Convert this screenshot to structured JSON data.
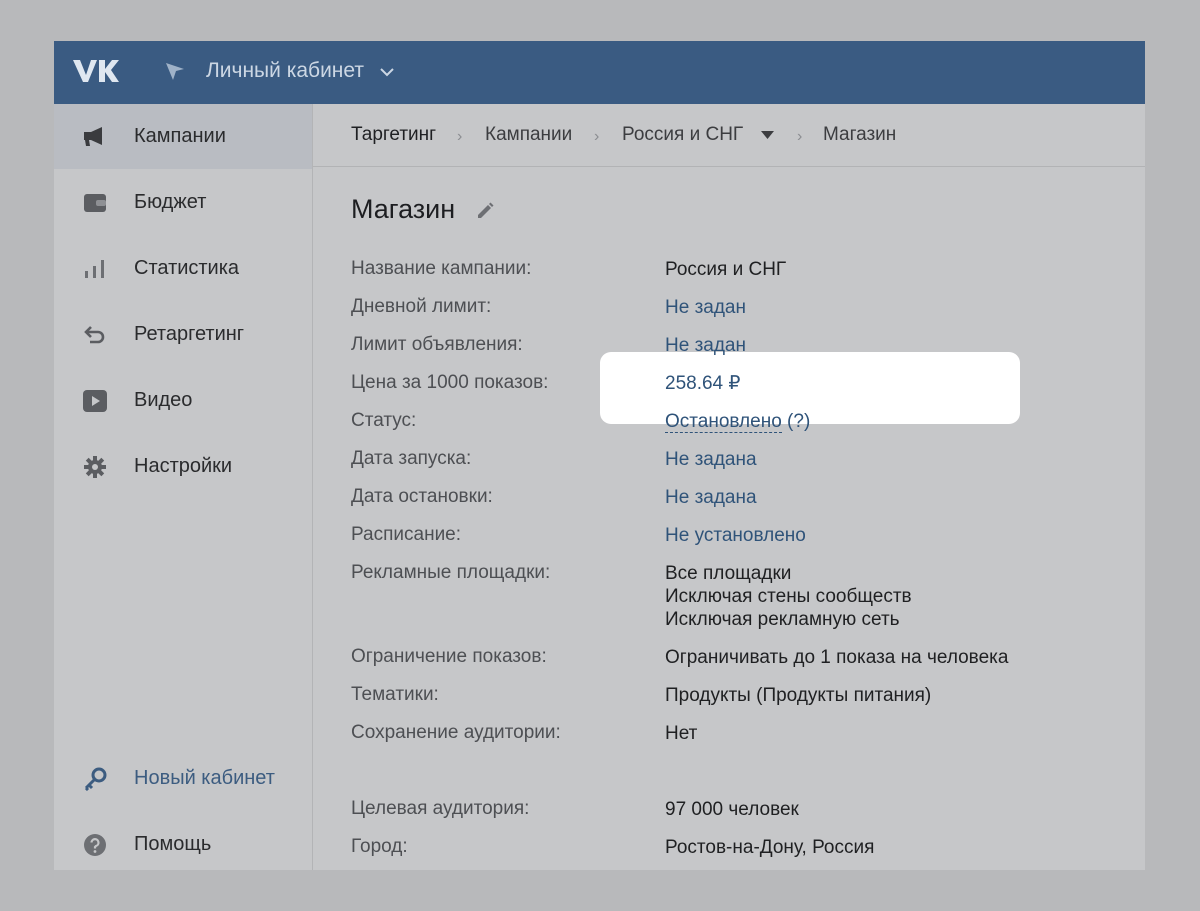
{
  "header": {
    "logo_icon": "vk-logo-icon",
    "title": "Личный кабинет"
  },
  "sidebar": {
    "items": [
      {
        "label": "Кампании",
        "icon": "megaphone-icon"
      },
      {
        "label": "Бюджет",
        "icon": "wallet-icon"
      },
      {
        "label": "Статистика",
        "icon": "bar-chart-icon"
      },
      {
        "label": "Ретаргетинг",
        "icon": "retarget-arrow-icon"
      },
      {
        "label": "Видео",
        "icon": "video-play-icon"
      },
      {
        "label": "Настройки",
        "icon": "gear-icon"
      }
    ],
    "bottom": [
      {
        "label": "Новый кабинет",
        "icon": "key-icon"
      },
      {
        "label": "Помощь",
        "icon": "help-icon"
      }
    ]
  },
  "breadcrumbs": [
    "Таргетинг",
    "Кампании",
    "Россия и СНГ",
    "Магазин"
  ],
  "page": {
    "title": "Магазин",
    "fields": [
      {
        "label": "Название кампании:",
        "value": "Россия и СНГ"
      },
      {
        "label": "Дневной лимит:",
        "value": "Не задан"
      },
      {
        "label": "Лимит объявления:",
        "value": "Не задан"
      },
      {
        "label": "Цена за 1000 показов:",
        "value": "258.64 ₽"
      },
      {
        "label": "Статус:",
        "value": "Остановлено",
        "extra": "(?)"
      },
      {
        "label": "Дата запуска:",
        "value": "Не задана"
      },
      {
        "label": "Дата остановки:",
        "value": "Не задана"
      },
      {
        "label": "Расписание:",
        "value": "Не установлено"
      },
      {
        "label": "Рекламные площадки:",
        "lines": [
          "Все площадки",
          "Исключая стены сообществ",
          "Исключая рекламную сеть"
        ]
      },
      {
        "label": "Ограничение показов:",
        "value": "Ограничивать до 1 показа на человека"
      },
      {
        "label": "Тематики:",
        "value": "Продукты (Продукты питания)"
      },
      {
        "label": "Сохранение аудитории:",
        "value": "Нет"
      },
      {
        "label": "Целевая аудитория:",
        "value": "97 000 человек"
      },
      {
        "label": "Город:",
        "value": "Ростов-на-Дону, Россия"
      }
    ]
  },
  "colors": {
    "header_bg": "#3a5b82",
    "link": "#2f5379",
    "page_bg": "#c6c7c9",
    "highlight": "#ffffff"
  }
}
